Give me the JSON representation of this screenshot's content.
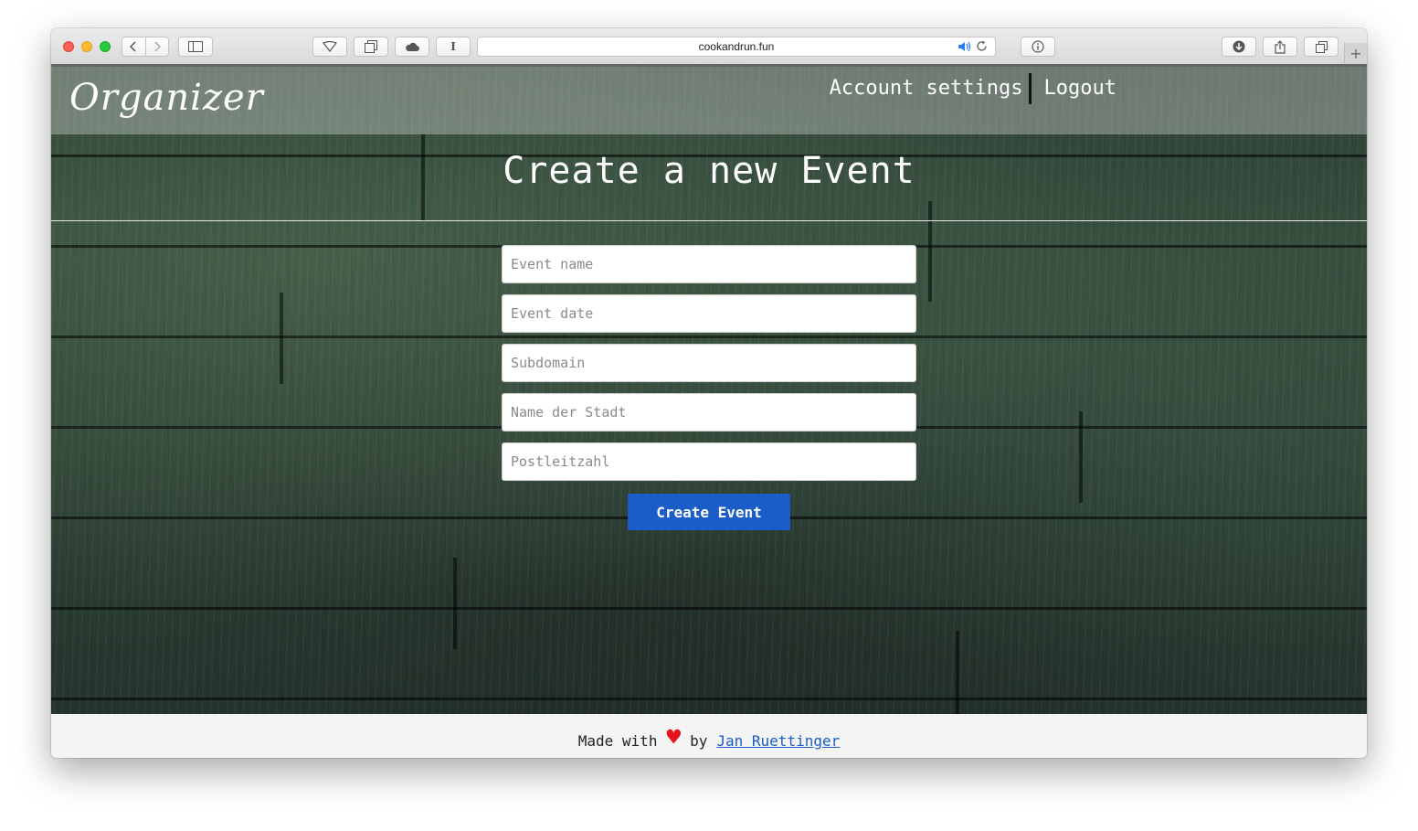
{
  "browser": {
    "url": "cookandrun.fun",
    "new_tab_label": "+"
  },
  "header": {
    "logo": "Organizer",
    "nav": {
      "account_settings": "Account settings",
      "logout": "Logout"
    }
  },
  "main": {
    "title": "Create a new Event",
    "fields": {
      "event_name": {
        "placeholder": "Event name",
        "value": ""
      },
      "event_date": {
        "placeholder": "Event date",
        "value": ""
      },
      "subdomain": {
        "placeholder": "Subdomain",
        "value": ""
      },
      "city": {
        "placeholder": "Name der Stadt",
        "value": ""
      },
      "postal_code": {
        "placeholder": "Postleitzahl",
        "value": ""
      }
    },
    "submit_label": "Create Event"
  },
  "footer": {
    "made_with": "Made with",
    "heart": "♥",
    "by": "by",
    "author": "Jan Ruettinger"
  },
  "colors": {
    "accent": "#1a5cc8",
    "heart": "#e4121b",
    "header_overlay": "#c8cdc8"
  }
}
